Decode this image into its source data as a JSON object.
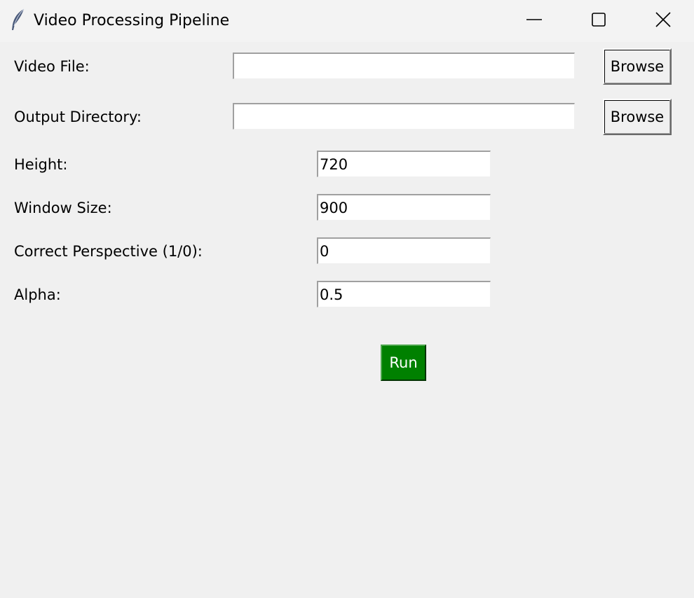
{
  "window": {
    "title": "Video Processing Pipeline",
    "icon": "feather-icon",
    "controls": {
      "minimize": "minimize-icon",
      "maximize": "maximize-icon",
      "close": "close-icon"
    }
  },
  "form": {
    "video_file": {
      "label": "Video File:",
      "value": "",
      "browse_label": "Browse"
    },
    "output_directory": {
      "label": "Output Directory:",
      "value": "",
      "browse_label": "Browse"
    },
    "height": {
      "label": "Height:",
      "value": "720"
    },
    "window_size": {
      "label": "Window Size:",
      "value": "900"
    },
    "correct_perspective": {
      "label": "Correct Perspective (1/0):",
      "value": "0"
    },
    "alpha": {
      "label": "Alpha:",
      "value": "0.5"
    }
  },
  "actions": {
    "run_label": "Run",
    "run_color": "#008000"
  },
  "colors": {
    "background": "#f0f0f0",
    "titlebar": "#f3f3f3"
  }
}
